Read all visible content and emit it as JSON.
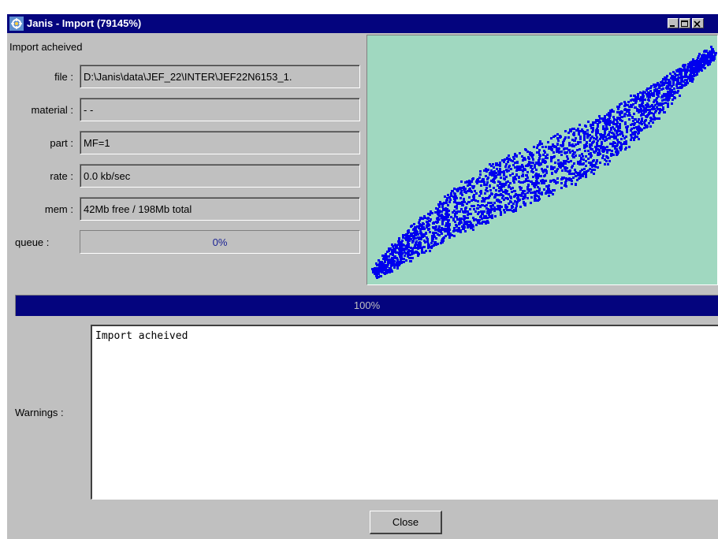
{
  "window": {
    "title": "Janis - Import (79145%)"
  },
  "status": {
    "text": "Import acheived"
  },
  "fields": {
    "file_label": "file :",
    "file_value": "D:\\Janis\\data\\JEF_22\\INTER\\JEF22N6153_1.",
    "material_label": "material :",
    "material_value": "- -",
    "part_label": "part :",
    "part_value": "MF=1",
    "rate_label": "rate :",
    "rate_value": "0.0 kb/sec",
    "mem_label": "mem :",
    "mem_value": "42Mb free / 198Mb total",
    "queue_label": "queue :"
  },
  "queue": {
    "percent_text": "0%",
    "fraction": 0
  },
  "progress": {
    "percent_text": "100%",
    "fraction": 1
  },
  "warnings": {
    "label": "Warnings :",
    "text": "Import acheived"
  },
  "buttons": {
    "close_label": "Close"
  },
  "colors": {
    "titlebar": "#04047e",
    "panel": "#c0c0c0",
    "plot_background": "#a0d8c0",
    "plot_points": "#0000ee",
    "progress_fill": "#04047e"
  },
  "icons": {
    "app": "janis-app-icon",
    "minimize": "minimize-icon",
    "maximize": "maximize-icon",
    "close": "close-icon"
  }
}
